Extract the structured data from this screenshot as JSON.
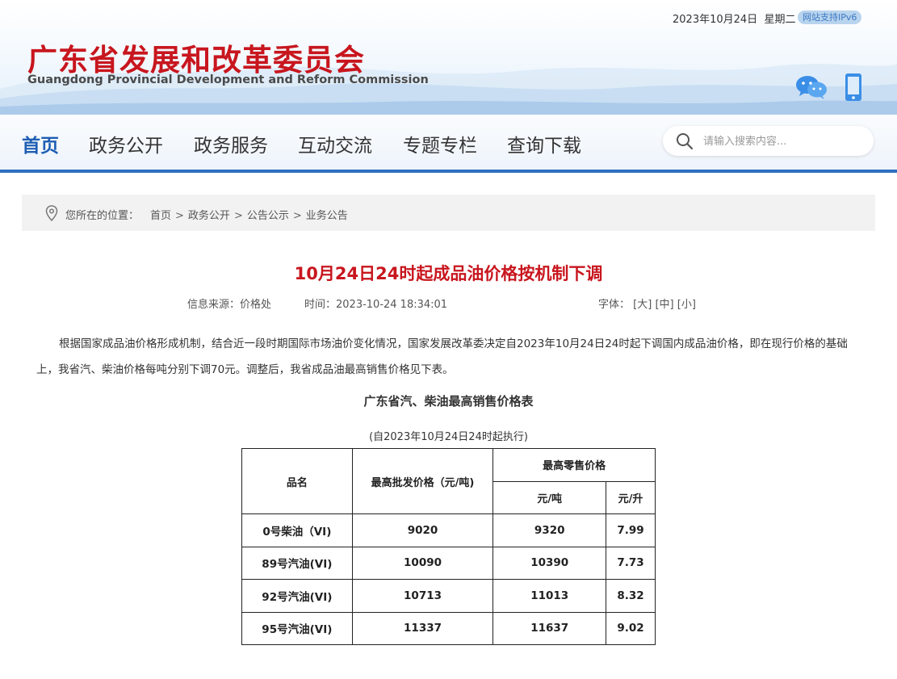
{
  "header": {
    "date": "2023年10月24日",
    "weekday": "星期二",
    "ipv6_badge": "网站支持IPv6",
    "site_title": "广东省发展和改革委员会",
    "site_subtitle": "Guangdong Provincial Development and Reform Commission",
    "icons": [
      "wechat-icon",
      "mobile-icon"
    ]
  },
  "nav": {
    "items": [
      "首页",
      "政务公开",
      "政务服务",
      "互动交流",
      "专题专栏",
      "查询下载"
    ],
    "active_index": 0,
    "search_placeholder": "请输入搜索内容..."
  },
  "breadcrumb": {
    "label": "您所在的位置：",
    "trail": [
      "首页",
      "政务公开",
      "公告公示",
      "业务公告"
    ],
    "separator": ">"
  },
  "article": {
    "title": "10月24日24时起成品油价格按机制下调",
    "source": "信息来源：价格处",
    "time": "时间：2023-10-24 18:34:01",
    "font_label": "字体：",
    "font_sizes": [
      "[大]",
      "[中]",
      "[小]"
    ],
    "paragraph": "根据国家成品油价格形成机制，结合近一段时期国际市场油价变化情况，国家发展改革委决定自2023年10月24日24时起下调国内成品油价格，即在现行价格的基础上，我省汽、柴油价格每吨分别下调70元。调整后，我省成品油最高销售价格见下表。",
    "table_title": "广东省汽、柴油最高销售价格表",
    "table_note": "(自2023年10月24日24时起执行)"
  },
  "price_table": {
    "headers": {
      "name": "品名",
      "wholesale": "最高批发价格（元/吨)",
      "retail": "最高零售价格",
      "retail_ton": "元/吨",
      "retail_liter": "元/升"
    },
    "rows": [
      {
        "name": "0号柴油（VI)",
        "wholesale": "9020",
        "retail_ton": "9320",
        "retail_liter": "7.99"
      },
      {
        "name": "89号汽油(VI)",
        "wholesale": "10090",
        "retail_ton": "10390",
        "retail_liter": "7.73"
      },
      {
        "name": "92号汽油(VI)",
        "wholesale": "10713",
        "retail_ton": "11013",
        "retail_liter": "8.32"
      },
      {
        "name": "95号汽油(VI)",
        "wholesale": "11337",
        "retail_ton": "11637",
        "retail_liter": "9.02"
      }
    ]
  },
  "colors": {
    "brand_red": "#c8161e",
    "nav_blue": "#2f6fc0",
    "active_nav": "#1e5eb3"
  }
}
